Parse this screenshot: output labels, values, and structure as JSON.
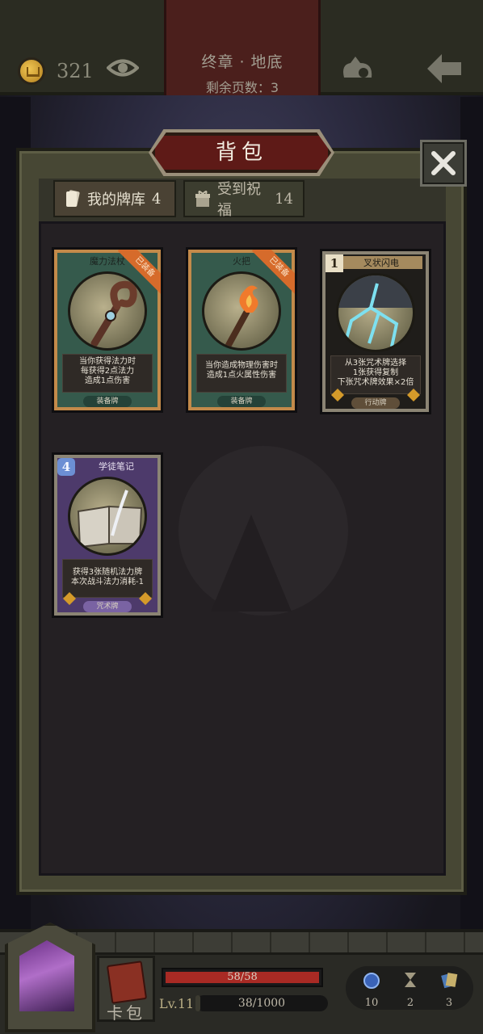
{
  "top_bar": {
    "coins": "321",
    "chapter_title": "终章 · 地底",
    "pages_left": "剩余页数：3"
  },
  "panel": {
    "title": "背包",
    "tabs": [
      {
        "label": "我的牌库",
        "count": "4",
        "selected": true
      },
      {
        "label": "受到祝福",
        "count": "14",
        "selected": false
      }
    ]
  },
  "cards": [
    {
      "name": "魔力法杖",
      "badge": "已装备",
      "description": "当你获得法力时\n每获得2点法力\n造成1点伤害",
      "type": "装备牌",
      "frame_color": "#355a4c",
      "art": "staff-icon"
    },
    {
      "name": "火把",
      "badge": "已装备",
      "description": "当你造成物理伤害时\n造成1点火属性伤害",
      "type": "装备牌",
      "frame_color": "#355a4c",
      "art": "torch-icon"
    },
    {
      "name": "叉状闪电",
      "cost": "1",
      "description": "从3张咒术牌选择\n1张获得复制\n下张咒术牌效果×2倍",
      "type": "行动牌",
      "frame_color": "#4a3b2d",
      "art": "lightning-icon"
    },
    {
      "name": "学徒笔记",
      "cost": "4",
      "description": "获得3张随机法力牌\n本次战斗法力消耗-1",
      "type": "咒术牌",
      "frame_color": "#4d3a6b",
      "art": "book-icon"
    }
  ],
  "hud": {
    "hp": "58/58",
    "hp_fraction": 1.0,
    "level": "Lv.11",
    "xp": "38/1000",
    "xp_fraction": 0.038,
    "deck_label": "卡包",
    "resources": [
      {
        "icon": "potion-icon",
        "value": "10"
      },
      {
        "icon": "hourglass-icon",
        "value": "2"
      },
      {
        "icon": "cards-icon",
        "value": "3"
      }
    ]
  }
}
